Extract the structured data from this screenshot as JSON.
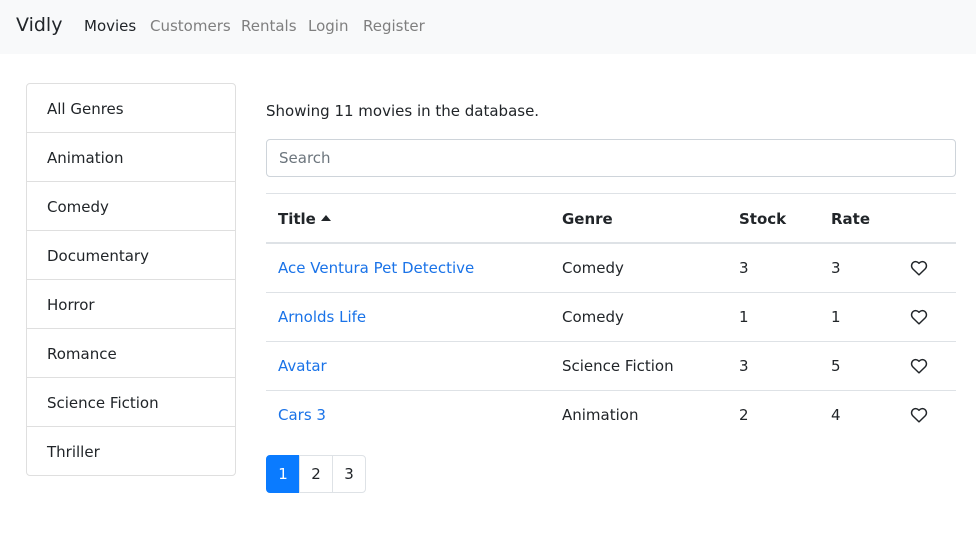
{
  "navbar": {
    "brand": "Vidly",
    "links": [
      "Movies",
      "Customers",
      "Rentals",
      "Login",
      "Register"
    ],
    "active": "Movies"
  },
  "genres": [
    "All Genres",
    "Animation",
    "Comedy",
    "Documentary",
    "Horror",
    "Romance",
    "Science Fiction",
    "Thriller"
  ],
  "summary": "Showing 11 movies in the database.",
  "search": {
    "placeholder": "Search",
    "value": ""
  },
  "table": {
    "headers": {
      "title": "Title",
      "genre": "Genre",
      "stock": "Stock",
      "rate": "Rate"
    },
    "sort": {
      "column": "title",
      "order": "asc"
    },
    "rows": [
      {
        "title": "Ace Ventura Pet Detective",
        "genre": "Comedy",
        "stock": "3",
        "rate": "3"
      },
      {
        "title": "Arnolds Life",
        "genre": "Comedy",
        "stock": "1",
        "rate": "1"
      },
      {
        "title": "Avatar",
        "genre": "Science Fiction",
        "stock": "3",
        "rate": "5"
      },
      {
        "title": "Cars 3",
        "genre": "Animation",
        "stock": "2",
        "rate": "4"
      }
    ],
    "like_icon": "heart-outline-icon"
  },
  "pagination": {
    "pages": [
      "1",
      "2",
      "3"
    ],
    "current": "1"
  },
  "colors": {
    "link": "#1a73e8",
    "primary": "#0a7bff",
    "navbar_bg": "#f8f9fa",
    "border": "#dee2e6"
  }
}
